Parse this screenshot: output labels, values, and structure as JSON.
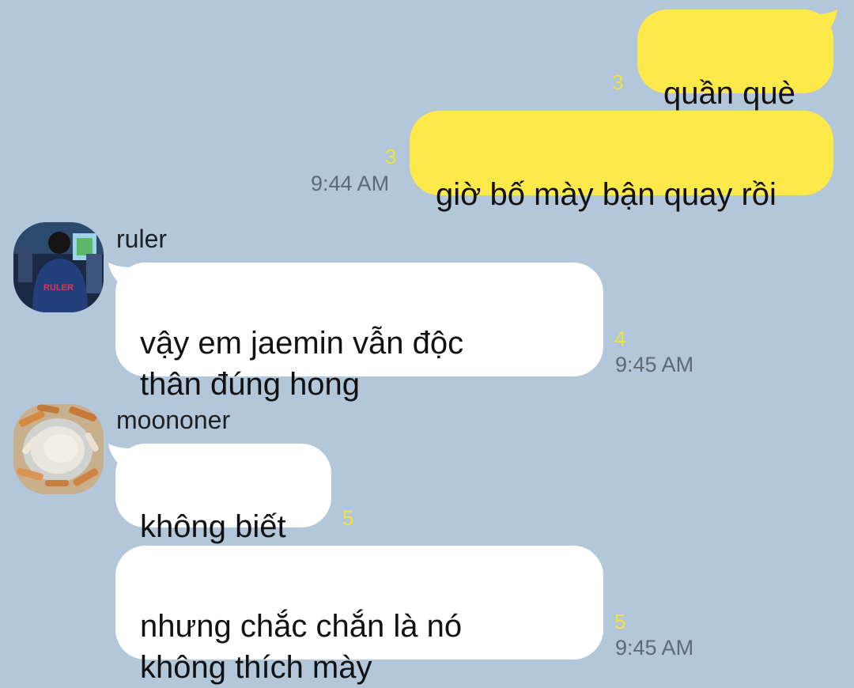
{
  "colors": {
    "background": "#b2c7da",
    "outgoing_bubble": "#fee94a",
    "incoming_bubble": "#ffffff",
    "unread_count": "#f3e13f",
    "timestamp": "#5c6a78"
  },
  "outgoing": [
    {
      "text": "quần què",
      "unread": "3",
      "time": ""
    },
    {
      "text": "giờ bố mày bận quay rồi",
      "unread": "3",
      "time": "9:44 AM"
    }
  ],
  "incoming": [
    {
      "sender": "ruler",
      "avatar_icon": "ruler-avatar-photo",
      "avatar_text": "RULER",
      "messages": [
        {
          "text": "vậy em jaemin vẫn độc\nthân đúng hong",
          "unread": "4",
          "time": "9:45 AM"
        }
      ]
    },
    {
      "sender": "moononer",
      "avatar_icon": "ashtray-avatar-photo",
      "messages": [
        {
          "text": "không biết",
          "unread": "5",
          "time": ""
        },
        {
          "text": "nhưng chắc chắn là nó\nkhông thích mày",
          "unread": "5",
          "time": "9:45 AM"
        }
      ]
    }
  ]
}
